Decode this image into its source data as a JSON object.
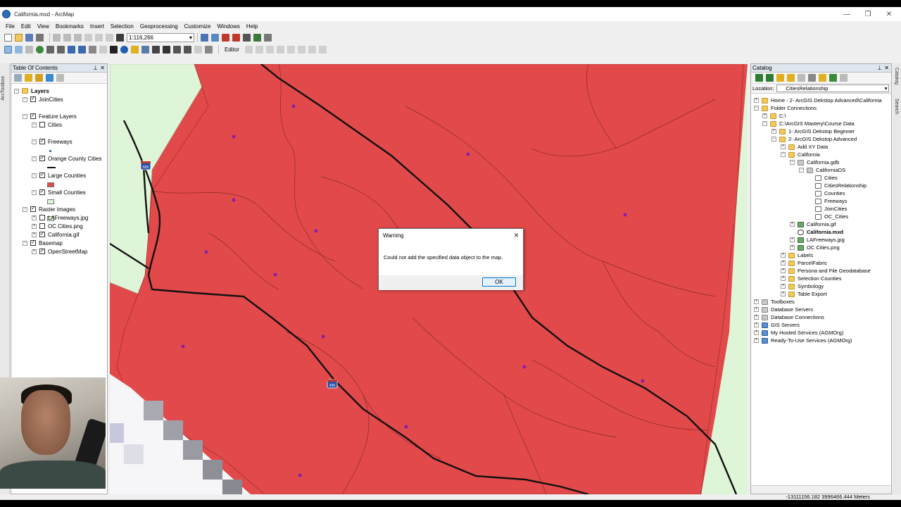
{
  "window": {
    "title": "California.mxd - ArcMap"
  },
  "menu": [
    "File",
    "Edit",
    "View",
    "Bookmarks",
    "Insert",
    "Selection",
    "Geoprocessing",
    "Customize",
    "Windows",
    "Help"
  ],
  "toolbar": {
    "scale": "1:116,266",
    "editor": "Editor"
  },
  "left_strip": {
    "label": "ArcToolbox"
  },
  "toc": {
    "title": "Table Of Contents",
    "root": "Layers",
    "items": [
      {
        "label": "JoinCities",
        "checked": true
      },
      {
        "label": "Feature Layers",
        "checked": true
      },
      {
        "label": "Cities",
        "checked": false
      },
      {
        "label": "Freeways",
        "checked": true
      },
      {
        "label": "Orange County Cities",
        "checked": true
      },
      {
        "label": "Large Counties",
        "checked": true
      },
      {
        "label": "Small Counties",
        "checked": true
      },
      {
        "label": "Raster Images",
        "checked": true
      },
      {
        "label": "LAFreeways.jpg",
        "checked": false
      },
      {
        "label": "OC Cities.png",
        "checked": false
      },
      {
        "label": "California.gif",
        "checked": true
      },
      {
        "label": "Basemap",
        "checked": true
      },
      {
        "label": "OpenStreetMap",
        "checked": true
      }
    ]
  },
  "map": {
    "shields": [
      "605",
      "405"
    ],
    "colors": {
      "county_fill": "#e2494a",
      "land": "#dff5d8",
      "freeway": "#000000",
      "city_point": "#8a1fa8"
    }
  },
  "dialog": {
    "title": "Warning",
    "message": "Could not add the specified data object to the map.",
    "ok": "OK"
  },
  "catalog": {
    "title": "Catalog",
    "location_label": "Location:",
    "location_value": "CitiesRelationship",
    "tree": [
      "Home - 2- ArcGIS Dekstop Advanced\\California",
      "Folder Connections",
      "C:\\",
      "C:\\ArcGIS Mastery\\Course Data",
      "1- ArcGIS Dekstop Beginner",
      "2- ArcGIS Dekstop Advanced",
      "Add XY Data",
      "California",
      "California.gdb",
      "CaliforniaDS",
      "Cities",
      "CitiesRelationship",
      "Counties",
      "Freeways",
      "JoinCities",
      "OC_Cities",
      "California.gif",
      "California.mxd",
      "LAFreeways.jpg",
      "OC Cities.png",
      "Labels",
      "ParcelFabric",
      "Persona and File Geodatabase",
      "Selection Counties",
      "Symbology",
      "Table Export",
      "Toolboxes",
      "Database Servers",
      "Database Connections",
      "GIS Servers",
      "My Hosted Services (AGMOrg)",
      "Ready-To-Use Services (AGMOrg)"
    ]
  },
  "right_strip": [
    "Catalog",
    "Search"
  ],
  "status": {
    "coords": "-13111156.182  3996466.444 Meters"
  }
}
